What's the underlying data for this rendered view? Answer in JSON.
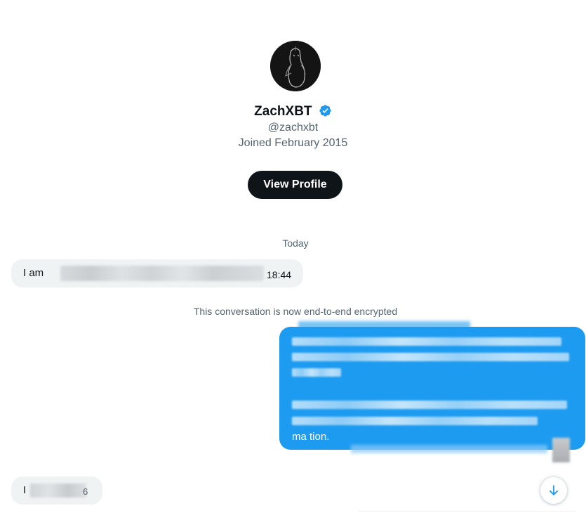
{
  "profile": {
    "avatar_icon": "penguin-avatar-icon",
    "name": "ZachXBT",
    "verified_icon": "verified-badge-icon",
    "handle": "@zachxbt",
    "joined": "Joined February 2015",
    "view_profile_label": "View Profile"
  },
  "conversation": {
    "day_separator": "Today",
    "encryption_notice": "This conversation is now end-to-end encrypted",
    "messages": [
      {
        "direction": "incoming",
        "visible_text": "I am",
        "redacted": true,
        "time": "18:44"
      },
      {
        "direction": "outgoing",
        "redacted": true,
        "visible_fragment": "ma                   tion."
      },
      {
        "direction": "incoming",
        "visible_text": "I",
        "redacted": true,
        "trailing_fragment": "6"
      }
    ]
  },
  "controls": {
    "scroll_down_icon": "arrow-down-icon"
  },
  "colors": {
    "accent": "#1d9bf0",
    "incoming_bubble": "#eff3f4",
    "primary_text": "#0f1419",
    "secondary_text": "#536471",
    "button_bg": "#0f1419"
  }
}
